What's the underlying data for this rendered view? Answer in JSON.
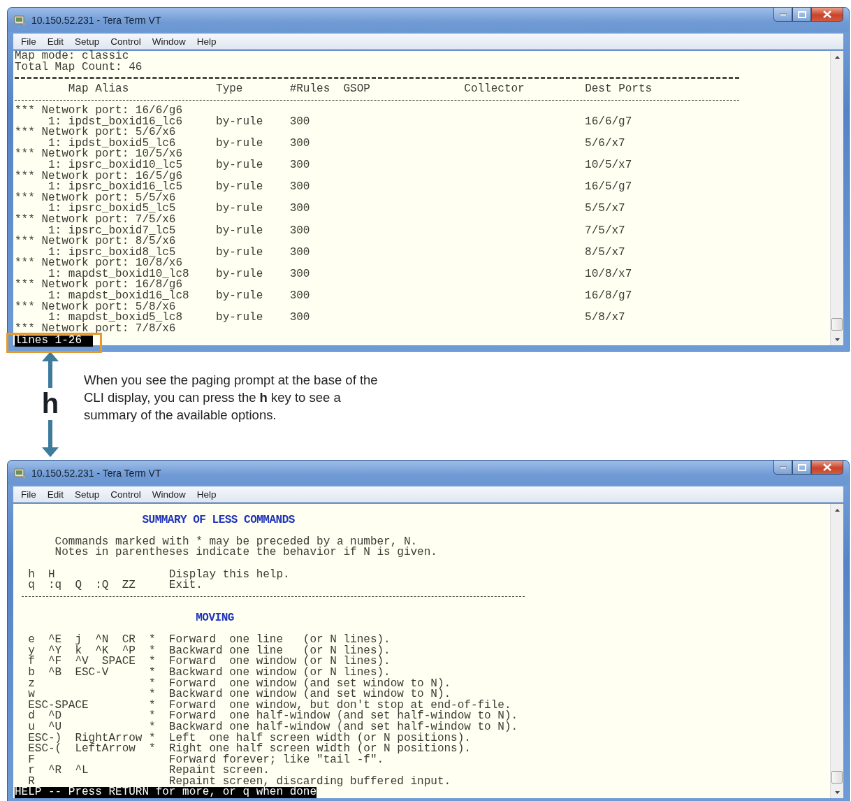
{
  "windows": [
    {
      "kind": "map-list",
      "title": "10.150.52.231 - Tera Term VT",
      "menu": [
        "File",
        "Edit",
        "Setup",
        "Control",
        "Window",
        "Help"
      ],
      "terminal": {
        "lines": [
          "Map mode: classic",
          "Total Map Count: 46"
        ],
        "columns": [
          "Map Alias",
          "Type",
          "#Rules",
          "GSOP",
          "Collector",
          "Dest Ports"
        ],
        "groups": [
          {
            "port": "*** Network port: 16/6/g6",
            "maps": [
              {
                "alias": "1: ipdst_boxid16_lc6",
                "type": "by-rule",
                "rules": "300",
                "dest": "16/6/g7"
              }
            ]
          },
          {
            "port": "*** Network port: 5/6/x6",
            "maps": [
              {
                "alias": "1: ipdst_boxid5_lc6",
                "type": "by-rule",
                "rules": "300",
                "dest": "5/6/x7"
              }
            ]
          },
          {
            "port": "*** Network port: 10/5/x6",
            "maps": [
              {
                "alias": "1: ipsrc_boxid10_lc5",
                "type": "by-rule",
                "rules": "300",
                "dest": "10/5/x7"
              }
            ]
          },
          {
            "port": "*** Network port: 16/5/g6",
            "maps": [
              {
                "alias": "1: ipsrc_boxid16_lc5",
                "type": "by-rule",
                "rules": "300",
                "dest": "16/5/g7"
              }
            ]
          },
          {
            "port": "*** Network port: 5/5/x6",
            "maps": [
              {
                "alias": "1: ipsrc_boxid5_lc5",
                "type": "by-rule",
                "rules": "300",
                "dest": "5/5/x7"
              }
            ]
          },
          {
            "port": "*** Network port: 7/5/x6",
            "maps": [
              {
                "alias": "1: ipsrc_boxid7_lc5",
                "type": "by-rule",
                "rules": "300",
                "dest": "7/5/x7"
              }
            ]
          },
          {
            "port": "*** Network port: 8/5/x6",
            "maps": [
              {
                "alias": "1: ipsrc_boxid8_lc5",
                "type": "by-rule",
                "rules": "300",
                "dest": "8/5/x7"
              }
            ]
          },
          {
            "port": "*** Network port: 10/8/x6",
            "maps": [
              {
                "alias": "1: mapdst_boxid10_lc8",
                "type": "by-rule",
                "rules": "300",
                "dest": "10/8/x7"
              }
            ]
          },
          {
            "port": "*** Network port: 16/8/g6",
            "maps": [
              {
                "alias": "1: mapdst_boxid16_lc8",
                "type": "by-rule",
                "rules": "300",
                "dest": "16/8/g7"
              }
            ]
          },
          {
            "port": "*** Network port: 5/8/x6",
            "maps": [
              {
                "alias": "1: mapdst_boxid5_lc8",
                "type": "by-rule",
                "rules": "300",
                "dest": "5/8/x7"
              }
            ]
          },
          {
            "port": "*** Network port: 7/8/x6"
          }
        ],
        "status": {
          "text": "lines 1-26",
          "highlighted": true
        }
      }
    },
    {
      "kind": "help",
      "title": "10.150.52.231 - Tera Term VT",
      "menu": [
        "File",
        "Edit",
        "Setup",
        "Control",
        "Window",
        "Help"
      ],
      "help": {
        "heading": "SUMMARY OF LESS COMMANDS",
        "intro": [
          "Commands marked with * may be preceded by a number, N.",
          "Notes in parentheses indicate the behavior if N is given."
        ],
        "basics": [
          {
            "keys": "h  H",
            "description": "Display this help."
          },
          {
            "keys": "q  :q  Q  :Q  ZZ",
            "description": "Exit."
          }
        ],
        "section": "MOVING",
        "commands": [
          {
            "keys": "e  ^E  j  ^N  CR",
            "star": "*",
            "description": "Forward  one line   (or N lines)."
          },
          {
            "keys": "y  ^Y  k  ^K  ^P",
            "star": "*",
            "description": "Backward one line   (or N lines)."
          },
          {
            "keys": "f  ^F  ^V  SPACE",
            "star": "*",
            "description": "Forward  one window (or N lines)."
          },
          {
            "keys": "b  ^B  ESC-V",
            "star": "*",
            "description": "Backward one window (or N lines)."
          },
          {
            "keys": "z",
            "star": "*",
            "description": "Forward  one window (and set window to N)."
          },
          {
            "keys": "w",
            "star": "*",
            "description": "Backward one window (and set window to N)."
          },
          {
            "keys": "ESC-SPACE",
            "star": "*",
            "description": "Forward  one window, but don't stop at end-of-file."
          },
          {
            "keys": "d  ^D",
            "star": "*",
            "description": "Forward  one half-window (and set half-window to N)."
          },
          {
            "keys": "u  ^U",
            "star": "*",
            "description": "Backward one half-window (and set half-window to N)."
          },
          {
            "keys": "ESC-)  RightArrow",
            "star": "*",
            "description": "Left  one half screen width (or N positions)."
          },
          {
            "keys": "ESC-(  LeftArrow",
            "star": "*",
            "description": "Right one half screen width (or N positions)."
          },
          {
            "keys": "F",
            "description": "Forward forever; like \"tail -f\"."
          },
          {
            "keys": "r  ^R  ^L",
            "description": "Repaint screen."
          },
          {
            "keys": "R",
            "description": "Repaint screen, discarding buffered input."
          }
        ],
        "prompt": "HELP -- Press RETURN for more, or q when done"
      }
    }
  ],
  "annotation": {
    "key": "h",
    "text": "When you see the paging prompt at the base of the CLI display, you can press the **h** key to see a summary of the available options."
  }
}
